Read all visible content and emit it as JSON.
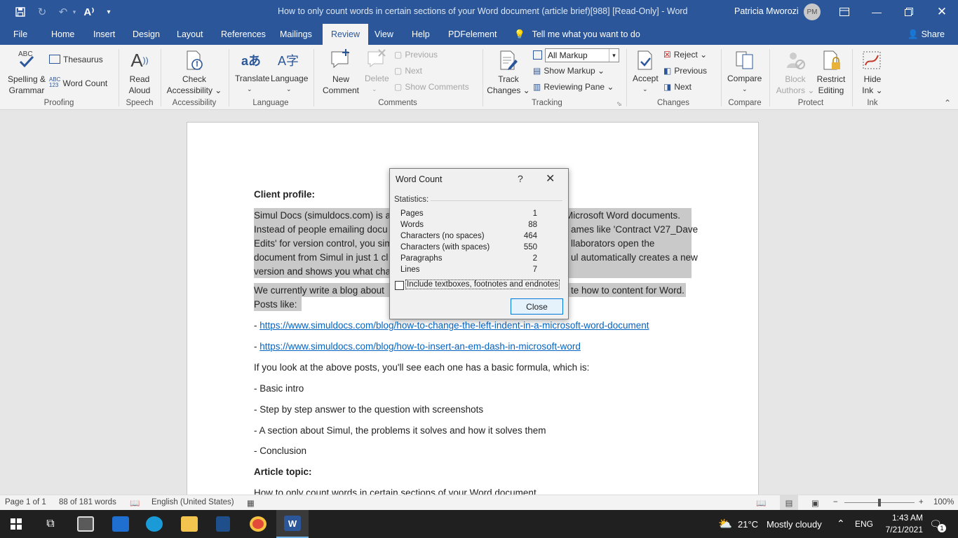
{
  "window": {
    "title": "How to only count words in certain sections of your Word document (article brief)[988] [Read-Only]  -  Word",
    "user_name": "Patricia Mworozi",
    "user_initials": "PM"
  },
  "tabs": [
    "File",
    "Home",
    "Insert",
    "Design",
    "Layout",
    "References",
    "Mailings",
    "Review",
    "View",
    "Help",
    "PDFelement"
  ],
  "active_tab": "Review",
  "tell_me": "Tell me what you want to do",
  "share": "Share",
  "ribbon": {
    "proofing": {
      "spelling": [
        "Spelling &",
        "Grammar"
      ],
      "thesaurus": "Thesaurus",
      "word_count": "Word Count",
      "group": "Proofing"
    },
    "speech": {
      "read_aloud": [
        "Read",
        "Aloud"
      ],
      "group": "Speech"
    },
    "accessibility": {
      "check": [
        "Check",
        "Accessibility ⌄"
      ],
      "group": "Accessibility"
    },
    "language": {
      "translate": "Translate",
      "language": "Language",
      "group": "Language"
    },
    "comments": {
      "new": [
        "New",
        "Comment"
      ],
      "delete": "Delete",
      "previous": "Previous",
      "next": "Next",
      "show": "Show Comments",
      "group": "Comments"
    },
    "tracking": {
      "track": [
        "Track",
        "Changes ⌄"
      ],
      "markup_select": "All Markup",
      "show_markup": "Show Markup ⌄",
      "reviewing_pane": "Reviewing Pane  ⌄",
      "group": "Tracking"
    },
    "changes": {
      "accept": "Accept",
      "reject": "Reject  ⌄",
      "previous": "Previous",
      "next": "Next",
      "group": "Changes"
    },
    "compare": {
      "compare": "Compare",
      "group": "Compare"
    },
    "protect": {
      "block": [
        "Block",
        "Authors ⌄"
      ],
      "restrict": [
        "Restrict",
        "Editing"
      ],
      "group": "Protect"
    },
    "ink": {
      "hide": [
        "Hide",
        "Ink ⌄"
      ],
      "group": "Ink"
    }
  },
  "document": {
    "heading_client": "Client profile:",
    "p1": [
      "Simul Docs (simuldocs.com) is a w",
      "Instead of people emailing docu",
      "Edits' for version control, you sim",
      "document from Simul in just 1 cl",
      "version and shows you what cha"
    ],
    "p1_right": [
      "Microsoft Word documents.",
      "ames like 'Contract V27_Dave",
      "llaborators open the",
      "ul automatically creates a new",
      ""
    ],
    "p2": [
      "We currently write a blog about",
      "Posts like:"
    ],
    "p2_right": "te how to content for Word.",
    "link1_prefix": "- ",
    "link1": "https://www.simuldocs.com/blog/how-to-change-the-left-indent-in-a-microsoft-word-document",
    "link2_prefix": "- ",
    "link2": "https://www.simuldocs.com/blog/how-to-insert-an-em-dash-in-microsoft-word",
    "p3": "If you look at the above posts, you'll see each one has a basic formula, which is:",
    "bullets": [
      "- Basic intro",
      "- Step by step answer to the question with screenshots",
      "- A section about Simul, the problems it solves and how it solves them",
      "- Conclusion"
    ],
    "heading_topic": "Article topic:",
    "topic_line": "How to only count words in certain sections of your Word document"
  },
  "dialog": {
    "title": "Word Count",
    "help": "?",
    "statistics": "Statistics:",
    "rows": [
      {
        "label": "Pages",
        "value": "1"
      },
      {
        "label": "Words",
        "value": "88"
      },
      {
        "label": "Characters (no spaces)",
        "value": "464"
      },
      {
        "label": "Characters (with spaces)",
        "value": "550"
      },
      {
        "label": "Paragraphs",
        "value": "2"
      },
      {
        "label": "Lines",
        "value": "7"
      }
    ],
    "checkbox_label": "Include textboxes, footnotes and endnotes",
    "checkbox_checked": false,
    "close": "Close"
  },
  "status": {
    "page": "Page 1 of 1",
    "words": "88 of 181 words",
    "language": "English (United States)",
    "zoom": "100%"
  },
  "taskbar": {
    "weather_temp": "21°C",
    "weather_text": "Mostly cloudy",
    "lang": "ENG",
    "time": "1:43 AM",
    "date": "7/21/2021",
    "notifications": "1"
  },
  "colors": {
    "word_blue": "#2b579a",
    "selection": "#c9c9c9",
    "link": "#0563c1"
  }
}
